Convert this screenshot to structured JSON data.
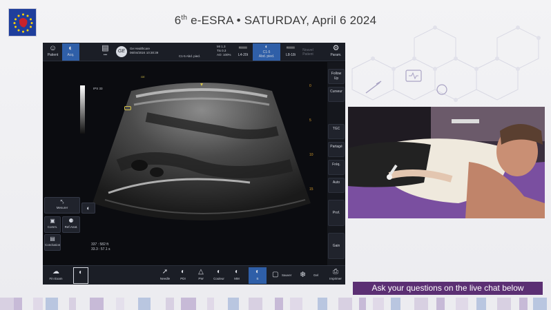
{
  "header": {
    "title_prefix": "6",
    "title_sup": "th",
    "title_rest": " e-ESRA • SATURDAY, April 6 2024"
  },
  "console": {
    "topbar": {
      "patient_label": "Patient",
      "acq_label": "Acq.",
      "hospital": "Ge Healthcare",
      "datetime": "06/04/2024 10:30:39",
      "probe_info": "C1-5   Abd. pied.",
      "mi": "MI 1.3",
      "tis": "Tis 0.3",
      "ao": "AO: 100%",
      "probe1_label": "L4-20t",
      "probe2_line1": "C1-5",
      "probe2_line2": "Abd. pied.",
      "probe3_label": "L8-18i",
      "user_label": "Nouvel Patient",
      "params_label": "Param."
    },
    "right_panel": {
      "follow_up": "Follow Up",
      "cursor": "Curseur",
      "tgc": "TGC",
      "share": "Partagé",
      "freq": "Fréq.",
      "auto": "Auto",
      "prof": "Prof.",
      "gain": "Gain"
    },
    "image": {
      "ips_label": "IPS 33",
      "probe_marker": "GE",
      "depth_ticks": [
        "0",
        "5",
        "10",
        "15"
      ],
      "measure_line1": "337 : 582 ft",
      "measure_line2": "33.3 : 57.1 s"
    },
    "left_tools": {
      "measure": "Mesurer",
      "comment": "Comm.",
      "body_mark": "Ref.Anat.",
      "conclusion": "Conclusion"
    },
    "bottombar": {
      "end_exam": "Fin Exam",
      "needle": "Needle",
      "pdi": "PDI",
      "pw": "PW",
      "color": "Couleur",
      "mm": "MM",
      "b": "B",
      "save": "Sauver",
      "freeze": "Gel",
      "print": "Imprimer"
    }
  },
  "chat_banner": "Ask your questions on the live chat below",
  "colors": {
    "banner_bg": "#5b2f73",
    "active_blue": "#2f5fa8",
    "depth_orange": "#d39b2c"
  }
}
